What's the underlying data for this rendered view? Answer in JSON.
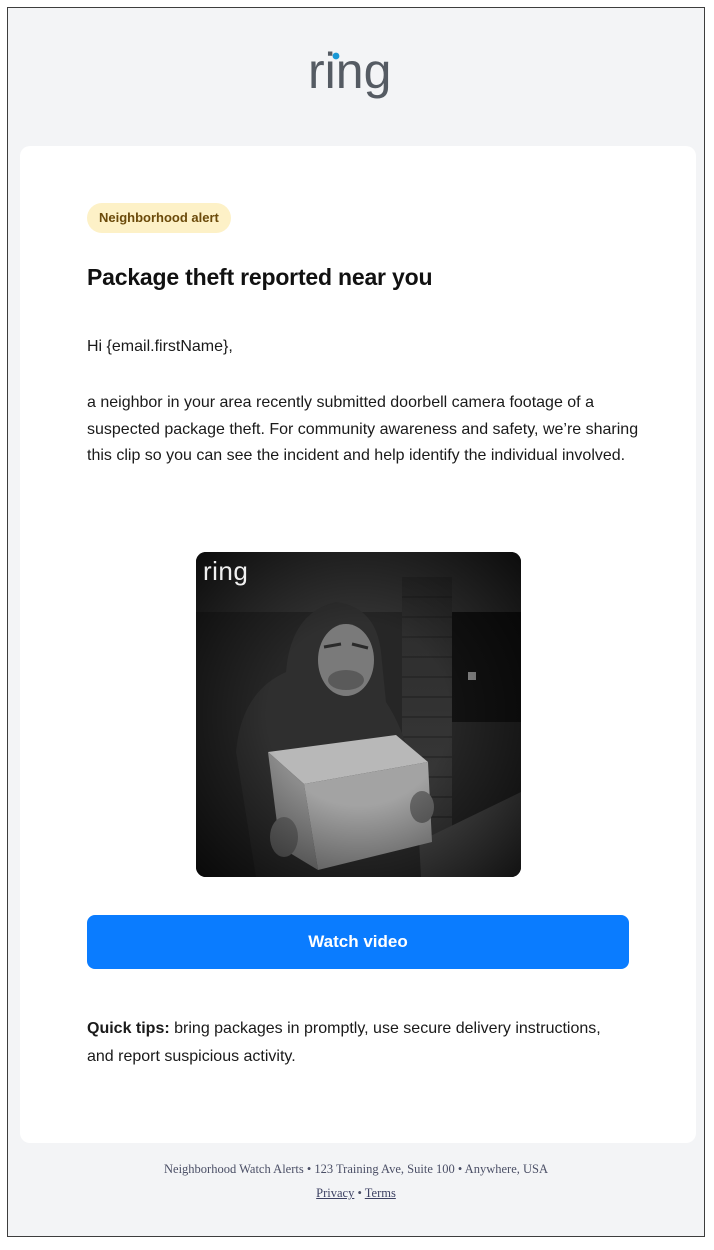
{
  "header": {
    "logo_text": "ring",
    "logo_dot_color": "#1998d5"
  },
  "card": {
    "badge": "Neighborhood alert",
    "title": "Package theft reported near you",
    "greeting": "Hi {email.firstName},",
    "body": "a neighbor in your area recently submitted doorbell camera footage of a suspected package theft. For community awareness and safety, we’re sharing this clip so you can see the incident and help identify the individual involved.",
    "video_watermark": "ring",
    "button_label": "Watch video",
    "tips_label": "Quick tips:",
    "tips_text": " bring packages in promptly, use secure delivery instructions, and report suspicious activity."
  },
  "footer": {
    "address_line": "Neighborhood Watch Alerts • 123 Training Ave, Suite 100 • Anywhere, USA",
    "privacy_link": "Privacy",
    "separator": " • ",
    "terms_link": "Terms"
  },
  "colors": {
    "accent": "#0a7cff",
    "badge_bg": "#fdf1c7",
    "badge_text": "#6b4a0a",
    "page_bg": "#f3f4f6"
  }
}
